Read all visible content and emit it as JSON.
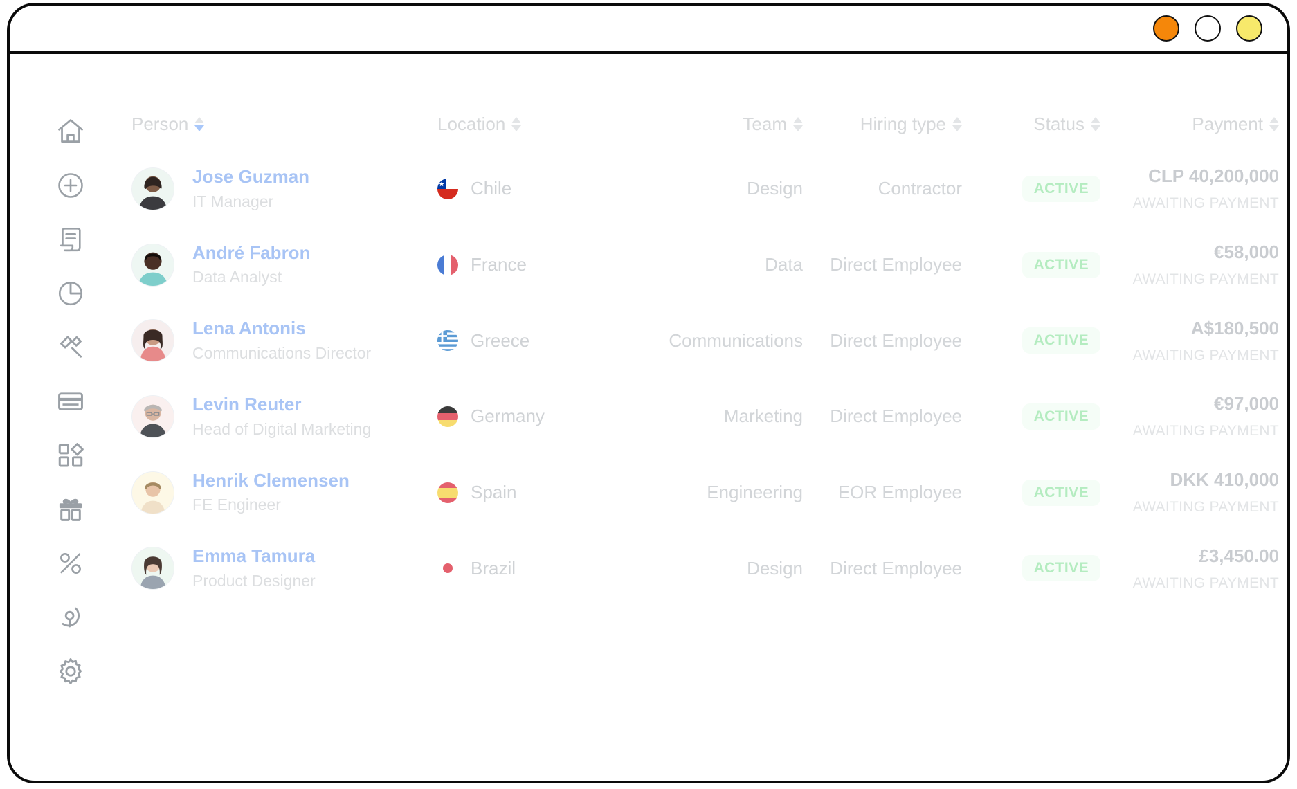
{
  "window": {
    "lights": [
      {
        "name": "close-button",
        "color": "#F5870A"
      },
      {
        "name": "minimize-button",
        "color": "#FFFFFF"
      },
      {
        "name": "maximize-button",
        "color": "#F7E96B"
      }
    ]
  },
  "sidebar": {
    "items": [
      {
        "icon": "home-icon",
        "label": "Home"
      },
      {
        "icon": "plus-circle-icon",
        "label": "Add"
      },
      {
        "icon": "document-scroll-icon",
        "label": "Contracts"
      },
      {
        "icon": "pie-chart-icon",
        "label": "Reports"
      },
      {
        "icon": "gavel-icon",
        "label": "Compliance"
      },
      {
        "icon": "credit-card-icon",
        "label": "Payments"
      },
      {
        "icon": "apps-grid-icon",
        "label": "Apps"
      },
      {
        "icon": "gift-icon",
        "label": "Perks"
      },
      {
        "icon": "percent-icon",
        "label": "Discounts"
      },
      {
        "icon": "globe-pin-icon",
        "label": "Global"
      },
      {
        "icon": "gear-icon",
        "label": "Settings"
      }
    ]
  },
  "table": {
    "columns": [
      {
        "key": "person",
        "label": "Person",
        "align": "left",
        "sort": "desc"
      },
      {
        "key": "location",
        "label": "Location",
        "align": "left",
        "sort": "none"
      },
      {
        "key": "team",
        "label": "Team",
        "align": "right",
        "sort": "none"
      },
      {
        "key": "hiring",
        "label": "Hiring type",
        "align": "right",
        "sort": "none"
      },
      {
        "key": "status",
        "label": "Status",
        "align": "right",
        "sort": "none"
      },
      {
        "key": "payment",
        "label": "Payment",
        "align": "right",
        "sort": "none"
      }
    ],
    "rows": [
      {
        "name": "Jose Guzman",
        "role": "IT Manager",
        "country": "Chile",
        "flag": "flag-chile",
        "team": "Design",
        "hiring_type": "Contractor",
        "status": "ACTIVE",
        "payment_amount": "CLP 40,200,000",
        "payment_status": "AWAITING PAYMENT",
        "avatar": "avatar-jose-guzman"
      },
      {
        "name": "André Fabron",
        "role": "Data Analyst",
        "country": "France",
        "flag": "flag-france",
        "team": "Data",
        "hiring_type": "Direct Employee",
        "status": "ACTIVE",
        "payment_amount": "€58,000",
        "payment_status": "AWAITING PAYMENT",
        "avatar": "avatar-andre-fabron"
      },
      {
        "name": "Lena Antonis",
        "role": "Communications Director",
        "country": "Greece",
        "flag": "flag-greece",
        "team": "Communications",
        "hiring_type": "Direct Employee",
        "status": "ACTIVE",
        "payment_amount": "A$180,500",
        "payment_status": "AWAITING PAYMENT",
        "avatar": "avatar-lena-antonis"
      },
      {
        "name": "Levin Reuter",
        "role": "Head of Digital Marketing",
        "country": "Germany",
        "flag": "flag-germany",
        "team": "Marketing",
        "hiring_type": "Direct Employee",
        "status": "ACTIVE",
        "payment_amount": "€97,000",
        "payment_status": "AWAITING PAYMENT",
        "avatar": "avatar-levin-reuter"
      },
      {
        "name": "Henrik Clemensen",
        "role": "FE Engineer",
        "country": "Spain",
        "flag": "flag-spain",
        "team": "Engineering",
        "hiring_type": "EOR Employee",
        "status": "ACTIVE",
        "payment_amount": "DKK 410,000",
        "payment_status": "AWAITING PAYMENT",
        "avatar": "avatar-henrik-clemensen"
      },
      {
        "name": "Emma Tamura",
        "role": "Product Designer",
        "country": "Brazil",
        "flag": "flag-brazil",
        "team": "Design",
        "hiring_type": "Direct Employee",
        "status": "ACTIVE",
        "payment_amount": "£3,450.00",
        "payment_status": "AWAITING PAYMENT",
        "avatar": "avatar-emma-tamura"
      }
    ],
    "row_menu_icon": "kebab-menu-icon"
  },
  "colors": {
    "link": "#A8C4F5",
    "status_text": "#B4ECC0",
    "status_bg": "#F5FDF7",
    "muted": "#D2D5D8",
    "kebab": "#B0CBF7"
  }
}
